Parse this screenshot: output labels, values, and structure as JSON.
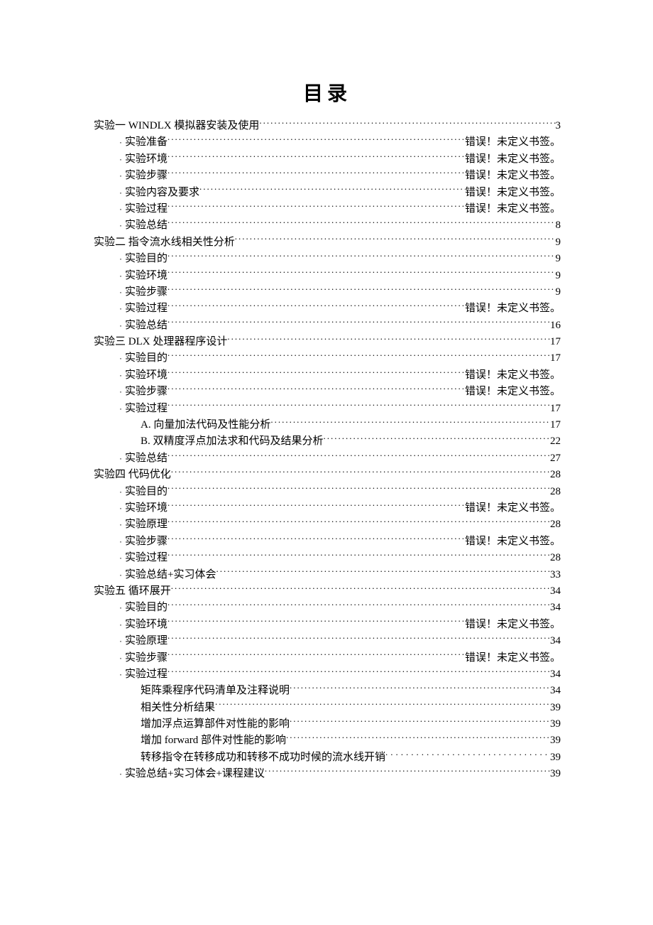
{
  "title": "目录",
  "error_text": "错误！未定义书签。",
  "toc": [
    {
      "level": 0,
      "bullet": "",
      "label": "实验一  WINDLX 模拟器安装及使用",
      "page": "3"
    },
    {
      "level": 1,
      "bullet": "·",
      "label": "实验准备",
      "page": "error"
    },
    {
      "level": 1,
      "bullet": "·",
      "label": "实验环境",
      "page": "error"
    },
    {
      "level": 1,
      "bullet": "·",
      "label": "实验步骤",
      "page": "error"
    },
    {
      "level": 1,
      "bullet": "·",
      "label": "实验内容及要求",
      "page": "error"
    },
    {
      "level": 1,
      "bullet": "·",
      "label": "实验过程",
      "page": "error"
    },
    {
      "level": 1,
      "bullet": "·",
      "label": "实验总结",
      "page": "8"
    },
    {
      "level": 0,
      "bullet": "",
      "label": "实验二  指令流水线相关性分析",
      "page": "9"
    },
    {
      "level": 1,
      "bullet": "·",
      "label": "实验目的",
      "page": "9"
    },
    {
      "level": 1,
      "bullet": "·",
      "label": "实验环境",
      "page": "9"
    },
    {
      "level": 1,
      "bullet": "·",
      "label": "实验步骤",
      "page": "9"
    },
    {
      "level": 1,
      "bullet": "·",
      "label": "实验过程",
      "page": "error"
    },
    {
      "level": 1,
      "bullet": "·",
      "label": "实验总结",
      "page": "16"
    },
    {
      "level": 0,
      "bullet": "",
      "label": "实验三  DLX 处理器程序设计",
      "page": "17"
    },
    {
      "level": 1,
      "bullet": "·",
      "label": "实验目的",
      "page": "17"
    },
    {
      "level": 1,
      "bullet": "·",
      "label": "实验环境",
      "page": "error"
    },
    {
      "level": 1,
      "bullet": "·",
      "label": "实验步骤",
      "page": "error"
    },
    {
      "level": 1,
      "bullet": "·",
      "label": "实验过程",
      "page": "17"
    },
    {
      "level": 2,
      "bullet": "",
      "label": "A. 向量加法代码及性能分析",
      "page": "17"
    },
    {
      "level": 2,
      "bullet": "",
      "label": "B. 双精度浮点加法求和代码及结果分析",
      "page": "22"
    },
    {
      "level": 1,
      "bullet": "·",
      "label": "实验总结",
      "page": "27"
    },
    {
      "level": 0,
      "bullet": "",
      "label": "实验四  代码优化",
      "page": "28"
    },
    {
      "level": 1,
      "bullet": "·",
      "label": "实验目的",
      "page": "28"
    },
    {
      "level": 1,
      "bullet": "·",
      "label": "实验环境",
      "page": "error"
    },
    {
      "level": 1,
      "bullet": "·",
      "label": "实验原理",
      "page": "28"
    },
    {
      "level": 1,
      "bullet": "·",
      "label": "实验步骤",
      "page": "error"
    },
    {
      "level": 1,
      "bullet": "·",
      "label": "实验过程",
      "page": "28"
    },
    {
      "level": 1,
      "bullet": "·",
      "label": "实验总结+实习体会",
      "page": "33"
    },
    {
      "level": 0,
      "bullet": "",
      "label": "实验五  循环展开",
      "page": "34"
    },
    {
      "level": 1,
      "bullet": "·",
      "label": "实验目的",
      "page": "34"
    },
    {
      "level": 1,
      "bullet": "·",
      "label": "实验环境",
      "page": "error"
    },
    {
      "level": 1,
      "bullet": "·",
      "label": "实验原理",
      "page": "34"
    },
    {
      "level": 1,
      "bullet": "·",
      "label": "实验步骤",
      "page": "error"
    },
    {
      "level": 1,
      "bullet": "·",
      "label": "实验过程",
      "page": "34"
    },
    {
      "level": 2,
      "bullet": "",
      "label": "矩阵乘程序代码清单及注释说明",
      "page": "34"
    },
    {
      "level": 2,
      "bullet": "",
      "label": "相关性分析结果",
      "page": "39"
    },
    {
      "level": 2,
      "bullet": "",
      "label": "增加浮点运算部件对性能的影响",
      "page": "39"
    },
    {
      "level": 2,
      "bullet": "",
      "label": "增加 forward 部件对性能的影响",
      "page": "39"
    },
    {
      "level": 2,
      "bullet": "",
      "label": "转移指令在转移成功和转移不成功时候的流水线开销",
      "page": "39",
      "spaced": true
    },
    {
      "level": 1,
      "bullet": "·",
      "label": "实验总结+实习体会+课程建议",
      "page": "39"
    }
  ]
}
